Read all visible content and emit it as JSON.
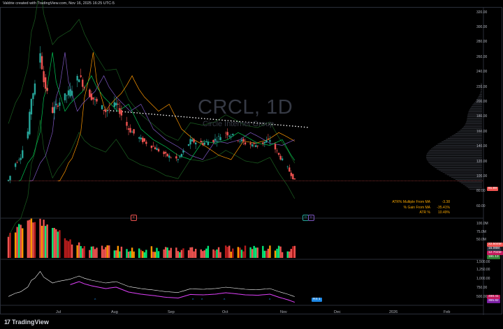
{
  "header": {
    "text": "Valdrie created with TradingView.com, Nov 16, 2025 16:25 UTC-5"
  },
  "watermark": {
    "ticker": "CRCL, 1D",
    "name": "Circle Internet Group"
  },
  "brand": {
    "logo_text": "TradingView",
    "logo_mark": "17"
  },
  "stats": [
    {
      "label": "ATR% Multiple From MA",
      "value": "-3.38"
    },
    {
      "label": "% Gain From MA",
      "value": "-35.41%"
    },
    {
      "label": "ATR %",
      "value": "10.49%"
    }
  ],
  "price_axis": {
    "ticks": [
      "320.00",
      "300.00",
      "280.00",
      "260.00",
      "240.00",
      "220.00",
      "200.00",
      "180.00",
      "160.00",
      "140.00",
      "120.00",
      "100.00",
      "80.00",
      "60.00"
    ]
  },
  "volume_axis": {
    "ticks": [
      "100.0M",
      "75.0M",
      "50.0M"
    ]
  },
  "osc_axis": {
    "ticks": [
      "1,500.00",
      "1,250.00",
      "1,000.00",
      "750.00",
      "500.00"
    ]
  },
  "time_axis": {
    "labels": [
      "Jul",
      "Aug",
      "Sep",
      "Oct",
      "Nov",
      "Dec",
      "2026",
      "Feb"
    ]
  },
  "last_price_tag": "81.89",
  "volume_tags": [
    "22.504M",
    "15.06M",
    "12.704M",
    "191.13"
  ],
  "osc_tags": [
    "498.41",
    "365.82"
  ],
  "rs_tag": "RS 1",
  "event_badges": {
    "earnings": "E",
    "dividend": [
      "D",
      "D"
    ]
  },
  "colors": {
    "up": "#26a69a",
    "down": "#ef5350",
    "vol_up": "#00e676",
    "vol_mid": "#ff9800",
    "ema_fast": "#00c853",
    "ema_mid": "#ff9800",
    "ema_slow": "#7e57c2",
    "rs_line": "#e040fb",
    "rs_up": "#2196f3",
    "price_tag": "#ef5350",
    "bb": "#1b5e20"
  },
  "chart_data": [
    {
      "type": "candlestick",
      "title": "CRCL, 1D",
      "xlabel": "",
      "ylabel": "",
      "x_range": [
        "2025-06-05",
        "2026-02-28"
      ],
      "ylim": [
        50,
        325
      ],
      "last_price": 81.89,
      "sample_closes": [
        {
          "date": "2025-06-05",
          "close": 83
        },
        {
          "date": "2025-06-09",
          "close": 107
        },
        {
          "date": "2025-06-12",
          "close": 117
        },
        {
          "date": "2025-06-16",
          "close": 151
        },
        {
          "date": "2025-06-18",
          "close": 199
        },
        {
          "date": "2025-06-20",
          "close": 215
        },
        {
          "date": "2025-06-23",
          "close": 263
        },
        {
          "date": "2025-06-25",
          "close": 222
        },
        {
          "date": "2025-06-30",
          "close": 180
        },
        {
          "date": "2025-07-03",
          "close": 191
        },
        {
          "date": "2025-07-10",
          "close": 208
        },
        {
          "date": "2025-07-15",
          "close": 230
        },
        {
          "date": "2025-07-18",
          "close": 214
        },
        {
          "date": "2025-07-22",
          "close": 200
        },
        {
          "date": "2025-07-30",
          "close": 180
        },
        {
          "date": "2025-08-05",
          "close": 190
        },
        {
          "date": "2025-08-12",
          "close": 155
        },
        {
          "date": "2025-08-19",
          "close": 140
        },
        {
          "date": "2025-08-26",
          "close": 130
        },
        {
          "date": "2025-09-02",
          "close": 118
        },
        {
          "date": "2025-09-09",
          "close": 112
        },
        {
          "date": "2025-09-16",
          "close": 138
        },
        {
          "date": "2025-09-23",
          "close": 135
        },
        {
          "date": "2025-09-30",
          "close": 140
        },
        {
          "date": "2025-10-06",
          "close": 150
        },
        {
          "date": "2025-10-10",
          "close": 145
        },
        {
          "date": "2025-10-17",
          "close": 135
        },
        {
          "date": "2025-10-24",
          "close": 132
        },
        {
          "date": "2025-10-31",
          "close": 140
        },
        {
          "date": "2025-11-05",
          "close": 118
        },
        {
          "date": "2025-11-10",
          "close": 100
        },
        {
          "date": "2025-11-14",
          "close": 81.89
        }
      ],
      "volume_axis": [
        "100.0M",
        "75.0M",
        "50.0M"
      ],
      "oscillator_axis": [
        "1,500.00",
        "1,250.00",
        "1,000.00",
        "750.00",
        "500.00"
      ]
    }
  ]
}
